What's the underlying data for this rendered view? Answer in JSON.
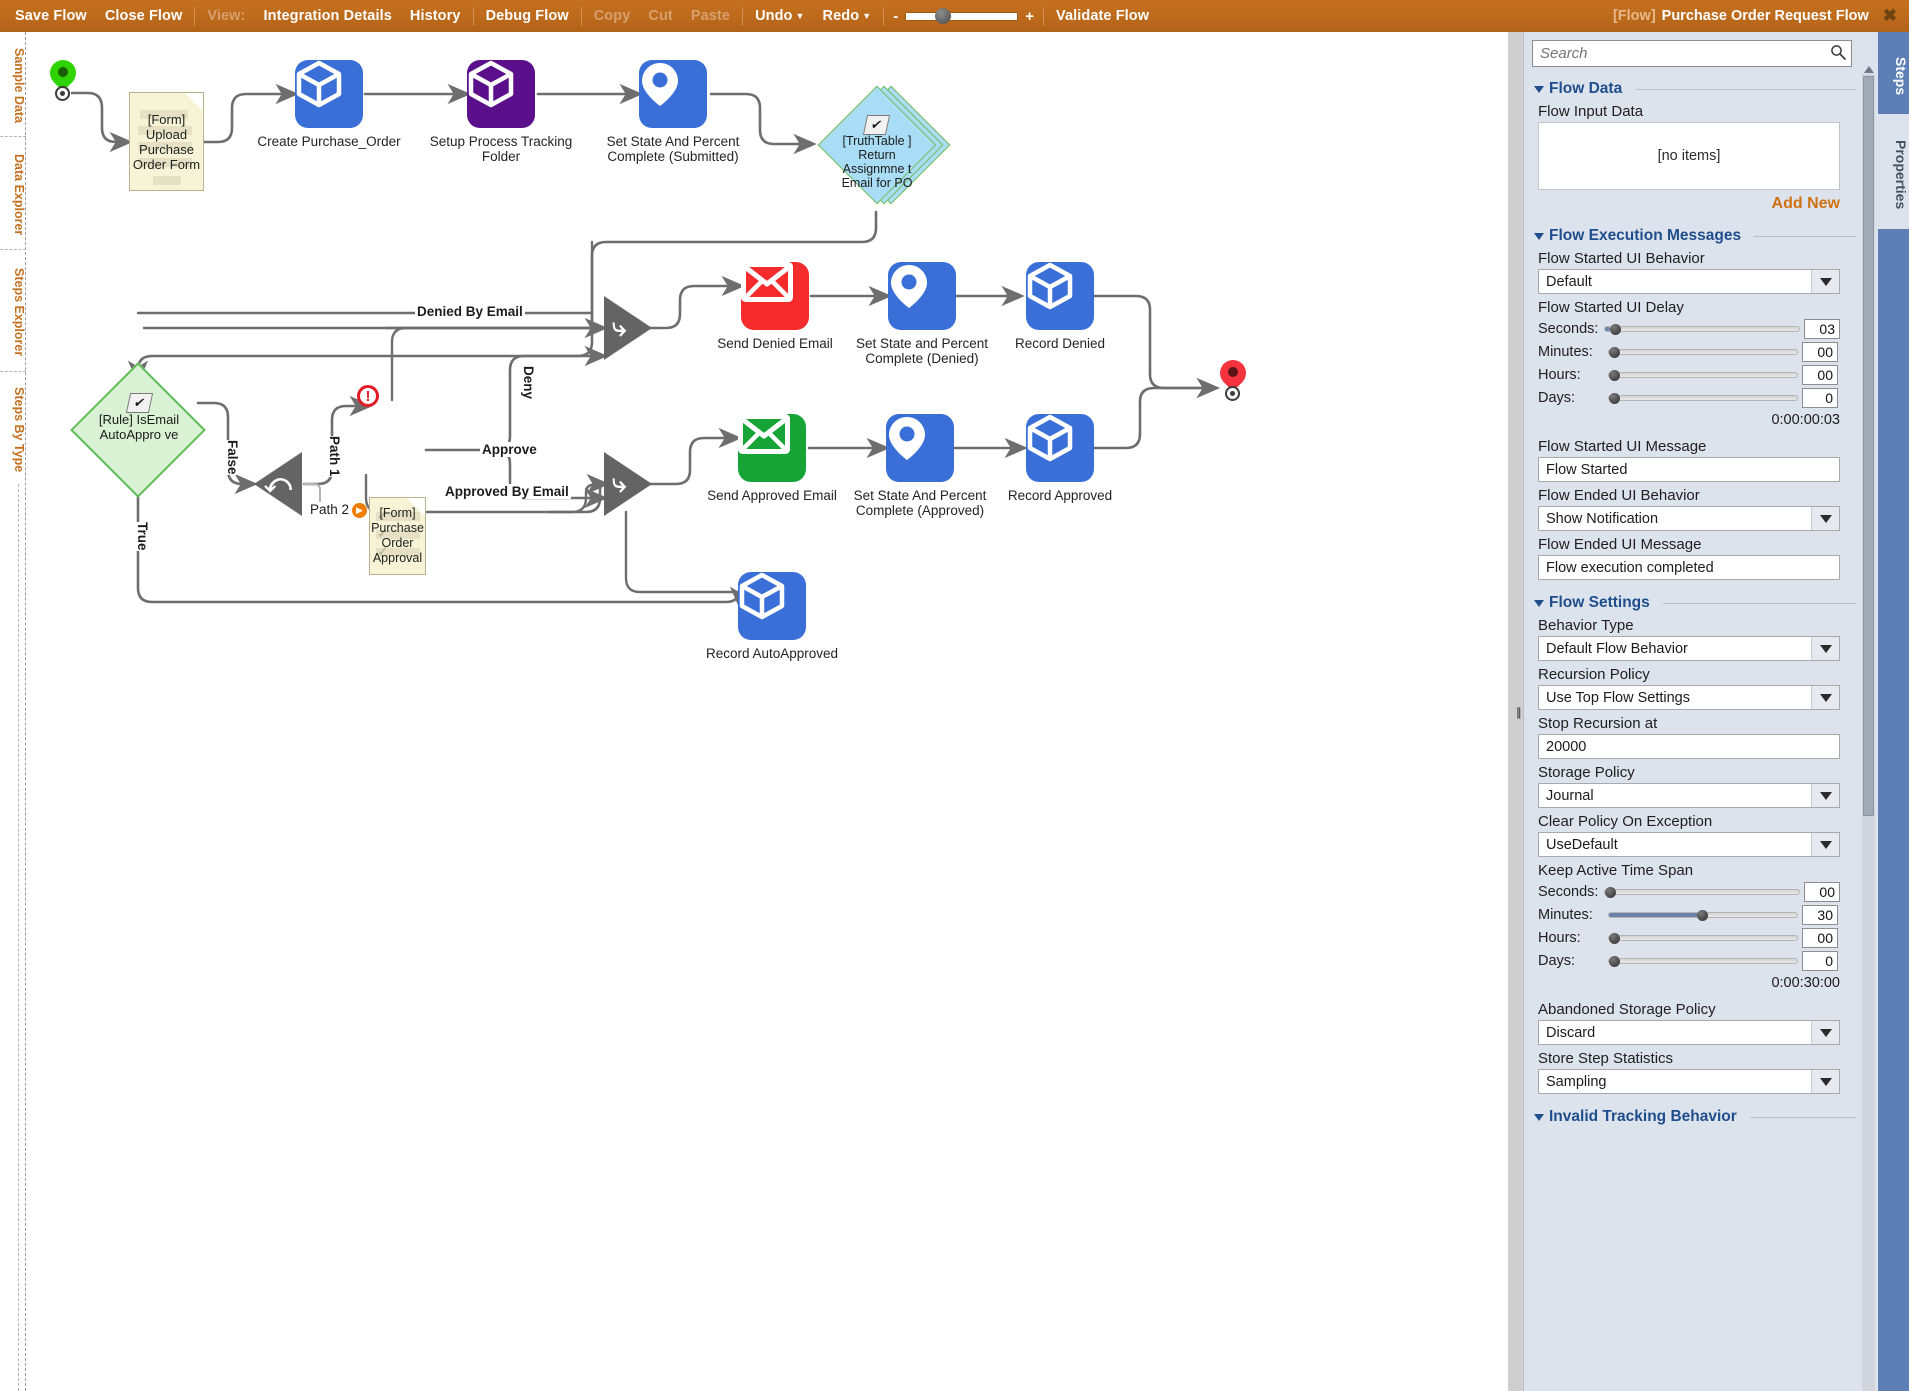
{
  "toolbar": {
    "items": [
      {
        "label": "Save Flow",
        "dim": false
      },
      {
        "label": "Close Flow",
        "dim": false
      },
      {
        "label": "View:",
        "dim": true
      },
      {
        "label": "Integration Details",
        "dim": false
      },
      {
        "label": "History",
        "dim": false
      },
      {
        "label": "Debug Flow",
        "dim": false
      },
      {
        "label": "Copy",
        "dim": true
      },
      {
        "label": "Cut",
        "dim": true
      },
      {
        "label": "Paste",
        "dim": true
      },
      {
        "label": "Undo",
        "dim": false
      },
      {
        "label": "Redo",
        "dim": false
      },
      {
        "label": "Validate Flow",
        "dim": false
      }
    ],
    "save": "Save Flow",
    "close": "Close Flow",
    "view": "View:",
    "integration_details": "Integration Details",
    "history": "History",
    "debug_flow": "Debug Flow",
    "copy": "Copy",
    "cut": "Cut",
    "paste": "Paste",
    "undo": "Undo",
    "redo": "Redo",
    "validate_flow": "Validate Flow",
    "zoom_minus": "-",
    "zoom_plus": "+",
    "title_prefix": "[Flow]",
    "title_name": "Purchase Order Request Flow",
    "close_glyph": "✖"
  },
  "left_rail": {
    "tabs": [
      "Sample Data",
      "Data Explorer",
      "Steps Explorer",
      "Steps By Type"
    ]
  },
  "flow": {
    "nodes": [
      {
        "id": "start",
        "label": "",
        "kind": "start-pin"
      },
      {
        "id": "upload-form",
        "label": "[Form]\nUpload\nPurchase\nOrder Form",
        "kind": "form"
      },
      {
        "id": "create-po",
        "label": "Create Purchase_Order",
        "kind": "blue-cube"
      },
      {
        "id": "setup-folder",
        "label": "Setup Process Tracking\nFolder",
        "kind": "purple-cube"
      },
      {
        "id": "set-state-submitted",
        "label": "Set State And Percent\nComplete (Submitted)",
        "kind": "blue-pin"
      },
      {
        "id": "truthtable",
        "label": "[TruthTable\n] Return\nAssignmne\nt Email for\nPO",
        "kind": "truthtable"
      },
      {
        "id": "rule-isemail",
        "label": "[Rule]\nIsEmail\nAutoAppro\nve",
        "kind": "rule"
      },
      {
        "id": "po-approval-form",
        "label": "[Form]\nPurchase\nOrder\nApproval",
        "kind": "form"
      },
      {
        "id": "send-denied-email",
        "label": "Send Denied  Email",
        "kind": "red-mail"
      },
      {
        "id": "set-state-denied",
        "label": "Set State and Percent\nComplete (Denied)",
        "kind": "blue-pin"
      },
      {
        "id": "record-denied",
        "label": "Record Denied",
        "kind": "blue-cube"
      },
      {
        "id": "send-approved-email",
        "label": "Send Approved Email",
        "kind": "green-mail"
      },
      {
        "id": "set-state-approved",
        "label": "Set State And Percent\nComplete (Approved)",
        "kind": "blue-pin"
      },
      {
        "id": "record-approved",
        "label": "Record Approved",
        "kind": "blue-cube"
      },
      {
        "id": "record-autoapproved",
        "label": "Record AutoApproved",
        "kind": "blue-cube"
      },
      {
        "id": "end",
        "label": "",
        "kind": "end-pin"
      }
    ],
    "labels": {
      "upload_form": "[Form]\nUpload\nPurchase\nOrder Form",
      "create_po": "Create Purchase_Order",
      "setup_folder": "Setup Process Tracking\nFolder",
      "set_state_submitted": "Set State And Percent\nComplete (Submitted)",
      "truthtable": "[TruthTable\n] Return\nAssignmne\nt Email for\nPO",
      "rule_isemail": "[Rule]\nIsEmail\nAutoAppro\nve",
      "po_approval_form": "[Form]\nPurchase\nOrder\nApproval",
      "send_denied_email": "Send Denied  Email",
      "set_state_denied": "Set State and Percent\nComplete (Denied)",
      "record_denied": "Record Denied",
      "send_approved_email": "Send Approved Email",
      "set_state_approved": "Set State And Percent\nComplete (Approved)",
      "record_approved": "Record Approved",
      "record_autoapproved": "Record AutoApproved"
    },
    "edge_labels": {
      "denied_by_email": "Denied By  Email",
      "approved_by_email": "Approved By  Email",
      "approve": "Approve",
      "deny": "Deny",
      "false": "False",
      "true": "True",
      "path1": "Path 1",
      "path2": "Path 2"
    },
    "badges": {
      "error_glyph": "!",
      "check_glyph": "✔"
    }
  },
  "right_panel": {
    "search": {
      "placeholder": "Search",
      "value": ""
    },
    "groups": {
      "flow_data": "Flow Data",
      "flow_execution_messages": "Flow Execution Messages",
      "flow_settings": "Flow Settings",
      "invalid_tracking_behavior": "Invalid Tracking Behavior"
    },
    "flow_input_data": {
      "label": "Flow Input Data",
      "empty_text": "[no items]",
      "add_new": "Add New"
    },
    "flow_started_ui_behavior": {
      "label": "Flow Started UI Behavior",
      "value": "Default"
    },
    "flow_started_ui_delay": {
      "label": "Flow Started UI Delay",
      "seconds_label": "Seconds:",
      "seconds_value": "03",
      "minutes_label": "Minutes:",
      "minutes_value": "00",
      "hours_label": "Hours:",
      "hours_value": "00",
      "days_label": "Days:",
      "days_value": "0",
      "total": "0:00:00:03"
    },
    "flow_started_ui_message": {
      "label": "Flow Started UI Message",
      "value": "Flow Started"
    },
    "flow_ended_ui_behavior": {
      "label": "Flow Ended UI Behavior",
      "value": "Show Notification"
    },
    "flow_ended_ui_message": {
      "label": "Flow Ended UI Message",
      "value": "Flow execution completed"
    },
    "behavior_type": {
      "label": "Behavior Type",
      "value": "Default Flow Behavior"
    },
    "recursion_policy": {
      "label": "Recursion Policy",
      "value": "Use Top Flow Settings"
    },
    "stop_recursion_at": {
      "label": "Stop Recursion at",
      "value": "20000"
    },
    "storage_policy": {
      "label": "Storage Policy",
      "value": "Journal"
    },
    "clear_policy_on_exception": {
      "label": "Clear Policy On Exception",
      "value": "UseDefault"
    },
    "keep_active_time_span": {
      "label": "Keep Active Time Span",
      "seconds_label": "Seconds:",
      "seconds_value": "00",
      "minutes_label": "Minutes:",
      "minutes_value": "30",
      "hours_label": "Hours:",
      "hours_value": "00",
      "days_label": "Days:",
      "days_value": "0",
      "total": "0:00:30:00"
    },
    "abandoned_storage_policy": {
      "label": "Abandoned Storage Policy",
      "value": "Discard"
    },
    "store_step_statistics": {
      "label": "Store Step Statistics",
      "value": "Sampling"
    }
  },
  "right_tabs": {
    "steps": "Steps",
    "properties": "Properties"
  }
}
